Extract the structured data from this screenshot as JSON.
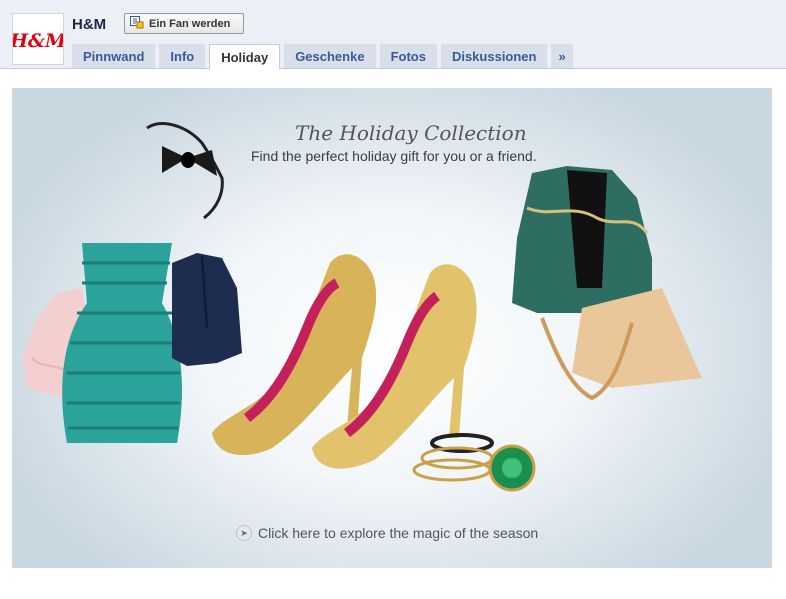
{
  "page": {
    "name": "H&M",
    "logo_text": "H&M"
  },
  "header": {
    "fan_button_label": "Ein Fan werden"
  },
  "tabs": [
    {
      "label": "Pinnwand"
    },
    {
      "label": "Info"
    },
    {
      "label": "Holiday"
    },
    {
      "label": "Geschenke"
    },
    {
      "label": "Fotos"
    },
    {
      "label": "Diskussionen"
    },
    {
      "label": "»"
    }
  ],
  "banner": {
    "title": "The Holiday Collection",
    "subtitle": "Find the perfect holiday gift for you or a friend.",
    "cta_label": "Click here to explore the magic of the season"
  },
  "colors": {
    "brand_red": "#e50010",
    "link_blue": "#3b5998",
    "tab_bg": "#d8dfea"
  }
}
